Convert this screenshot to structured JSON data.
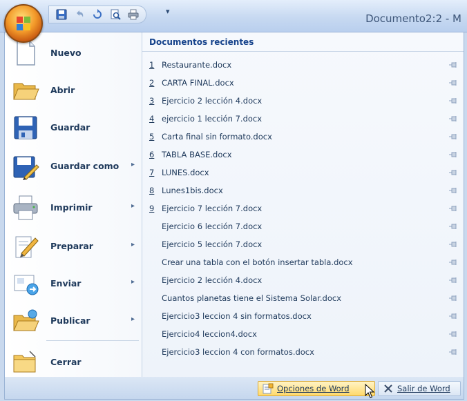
{
  "window": {
    "title": "Documento2:2 - M"
  },
  "quick_access": {
    "icons": [
      "save-icon",
      "undo-icon",
      "redo-icon",
      "print-preview-icon",
      "quick-print-icon"
    ],
    "dropdown": "▾"
  },
  "office_menu": {
    "items": [
      {
        "label": "Nuevo",
        "icon": "new-document-icon",
        "submenu": false
      },
      {
        "label": "Abrir",
        "icon": "open-folder-icon",
        "submenu": false
      },
      {
        "label": "Guardar",
        "icon": "save-icon",
        "submenu": false
      },
      {
        "label": "Guardar como",
        "icon": "save-as-icon",
        "submenu": true
      },
      {
        "label": "Imprimir",
        "icon": "printer-icon",
        "submenu": true
      },
      {
        "label": "Preparar",
        "icon": "prepare-icon",
        "submenu": true
      },
      {
        "label": "Enviar",
        "icon": "send-icon",
        "submenu": true
      },
      {
        "label": "Publicar",
        "icon": "publish-icon",
        "submenu": true
      },
      {
        "label": "Cerrar",
        "icon": "close-folder-icon",
        "submenu": false
      }
    ],
    "submenu_arrow": "▸"
  },
  "recent": {
    "header": "Documentos recientes",
    "documents": [
      {
        "num": "1",
        "name": "Restaurante.docx"
      },
      {
        "num": "2",
        "name": "CARTA FINAL.docx"
      },
      {
        "num": "3",
        "name": "Ejercicio 2 lección 4.docx"
      },
      {
        "num": "4",
        "name": "ejercicio 1 lección 7.docx"
      },
      {
        "num": "5",
        "name": "Carta final sin formato.docx"
      },
      {
        "num": "6",
        "name": "TABLA BASE.docx"
      },
      {
        "num": "7",
        "name": "LUNES.docx"
      },
      {
        "num": "8",
        "name": "Lunes1bis.docx"
      },
      {
        "num": "9",
        "name": "Ejercicio 7 lección 7.docx"
      },
      {
        "num": "",
        "name": "Ejercicio 6 lección 7.docx"
      },
      {
        "num": "",
        "name": "Ejercicio 5 lección 7.docx"
      },
      {
        "num": "",
        "name": "Crear una tabla con el botón insertar tabla.docx"
      },
      {
        "num": "",
        "name": "Ejercicio 2 lección 4.docx"
      },
      {
        "num": "",
        "name": "Cuantos planetas tiene el Sistema Solar.docx"
      },
      {
        "num": "",
        "name": "Ejercicio3 leccion 4 sin formatos.docx"
      },
      {
        "num": "",
        "name": "Ejercicio4 leccion4.docx"
      },
      {
        "num": "",
        "name": "Ejercicio3 leccion 4 con formatos.docx"
      }
    ]
  },
  "bottom": {
    "options_label": "Opciones de Word",
    "exit_label": "Salir de Word"
  },
  "colors": {
    "accent": "#15428b",
    "highlight": "#ffd96b",
    "frame": "#c9d9ee"
  }
}
